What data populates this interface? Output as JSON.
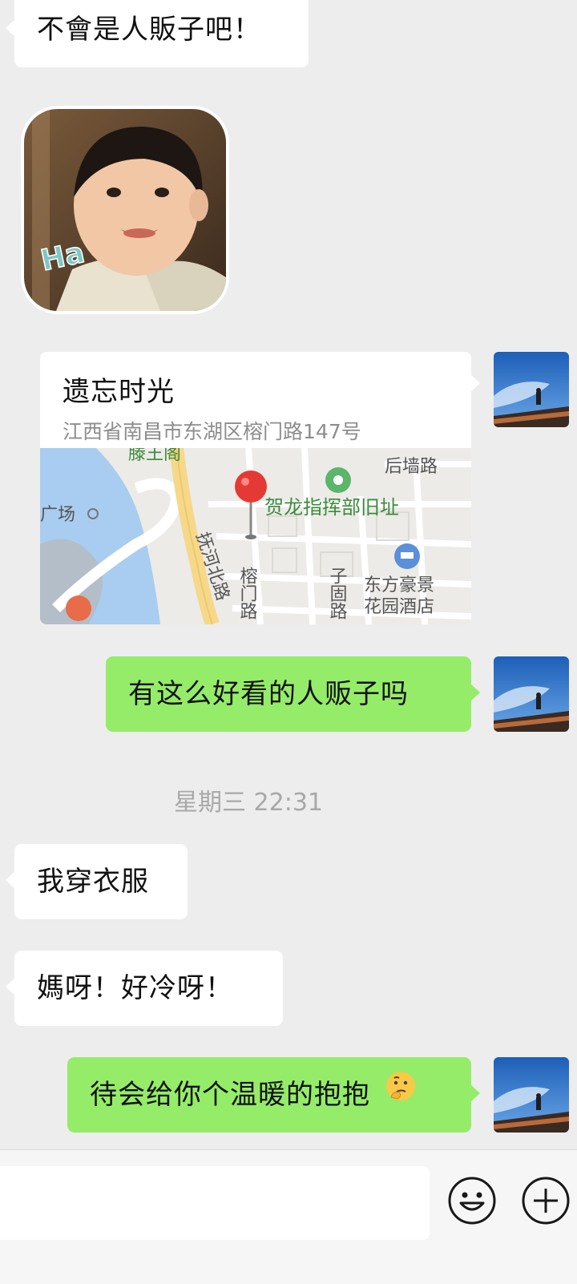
{
  "messages": {
    "m1": "不會是人販子吧！",
    "m2": "有这么好看的人贩子吗",
    "m3": "我穿衣服",
    "m4": "媽呀！好冷呀！",
    "m5": "待会给你个温暖的抱抱"
  },
  "sticker": {
    "text": "Ha"
  },
  "location": {
    "title": "遗忘时光",
    "address": "江西省南昌市东湖区榕门路147号",
    "map_labels": {
      "tengwang": "滕王阁",
      "houqiang": "后墙路",
      "guangchang": "广场",
      "helong": "贺龙指挥部旧址",
      "fuhe": "抚河北路",
      "rongmen": "榕门路",
      "zigu": "子固路",
      "hotel_line1": "东方豪景",
      "hotel_line2": "花园酒店"
    }
  },
  "time_divider": "星期三 22:31",
  "colors": {
    "background": "#ededed",
    "outgoing_bubble": "#95ec69",
    "incoming_bubble": "#ffffff",
    "map_label_green": "#3d8a3d",
    "pin_red": "#e53935"
  }
}
